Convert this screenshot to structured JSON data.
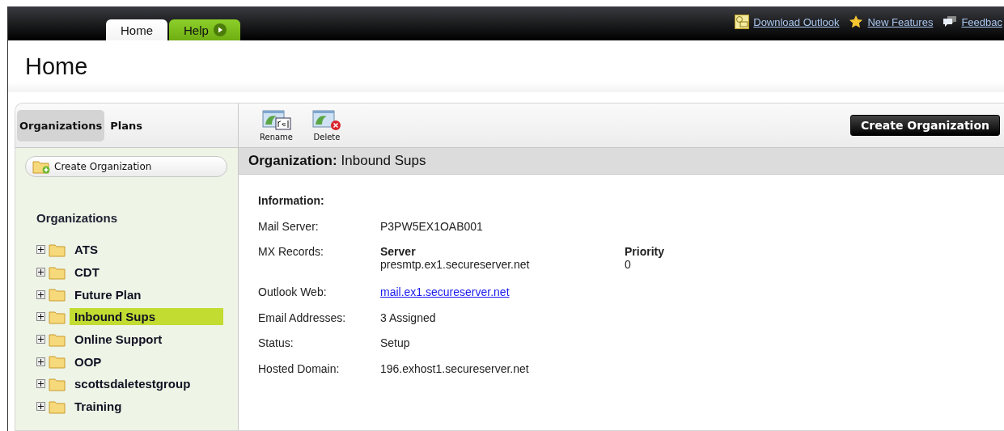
{
  "top_tabs": [
    {
      "label": "Home",
      "selected": true
    },
    {
      "label": "Help",
      "selected": false
    }
  ],
  "top_links": [
    {
      "kind": "outlook",
      "label": "Download Outlook"
    },
    {
      "kind": "star",
      "label": "New Features"
    },
    {
      "kind": "feedback",
      "label": "Feedbac"
    }
  ],
  "page_title": "Home",
  "sidebar": {
    "tabs": [
      {
        "label": "Organizations",
        "selected": true
      },
      {
        "label": "Plans",
        "selected": false
      }
    ],
    "create_button": "Create Organization",
    "tree_title": "Organizations",
    "items": [
      {
        "label": "ATS",
        "expanded": false,
        "selected": false
      },
      {
        "label": "CDT",
        "expanded": false,
        "selected": false
      },
      {
        "label": "Future Plan",
        "expanded": false,
        "selected": false
      },
      {
        "label": "Inbound Sups",
        "expanded": false,
        "selected": true
      },
      {
        "label": "Online Support",
        "expanded": false,
        "selected": false
      },
      {
        "label": "OOP",
        "expanded": false,
        "selected": false
      },
      {
        "label": "scottsdaletestgroup",
        "expanded": false,
        "selected": false
      },
      {
        "label": "Training",
        "expanded": false,
        "selected": false
      }
    ]
  },
  "toolbar": {
    "tools": [
      {
        "kind": "rename",
        "label": "Rename"
      },
      {
        "kind": "delete",
        "label": "Delete"
      }
    ],
    "create_button": "Create Organization"
  },
  "detail": {
    "label": "Organization:",
    "value": "Inbound Sups",
    "section": "Information:",
    "rows": [
      {
        "kind": "text",
        "label": "Mail Server:",
        "value": "P3PW5EX1OAB001"
      },
      {
        "kind": "mx",
        "label": "MX Records:",
        "server_heading": "Server",
        "server": "presmtp.ex1.secureserver.net",
        "priority_heading": "Priority",
        "priority": "0"
      },
      {
        "kind": "link",
        "label": "Outlook Web:",
        "value": "mail.ex1.secureserver.net"
      },
      {
        "kind": "text",
        "label": "Email Addresses:",
        "value": "3 Assigned"
      },
      {
        "kind": "text",
        "label": "Status:",
        "value": "Setup"
      },
      {
        "kind": "text",
        "label": "Hosted Domain:",
        "value": "196.exhost1.secureserver.net"
      }
    ]
  }
}
